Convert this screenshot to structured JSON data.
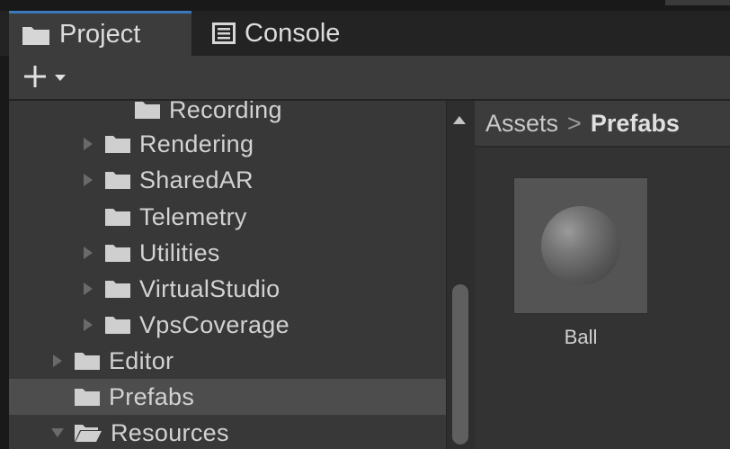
{
  "tabs": [
    {
      "label": "Project",
      "icon": "folder-icon",
      "active": true
    },
    {
      "label": "Console",
      "icon": "console-icon",
      "active": false
    }
  ],
  "toolbar": {
    "add_label": "+",
    "add_icon": "plus-icon",
    "dropdown_icon": "caret-down-icon"
  },
  "tree": {
    "items": [
      {
        "label": "Recording",
        "has_arrow": false,
        "expanded": false,
        "selected": false
      },
      {
        "label": "Rendering",
        "has_arrow": true,
        "expanded": false,
        "selected": false
      },
      {
        "label": "SharedAR",
        "has_arrow": true,
        "expanded": false,
        "selected": false
      },
      {
        "label": "Telemetry",
        "has_arrow": false,
        "expanded": false,
        "selected": false
      },
      {
        "label": "Utilities",
        "has_arrow": true,
        "expanded": false,
        "selected": false
      },
      {
        "label": "VirtualStudio",
        "has_arrow": true,
        "expanded": false,
        "selected": false
      },
      {
        "label": "VpsCoverage",
        "has_arrow": true,
        "expanded": false,
        "selected": false
      },
      {
        "label": "Editor",
        "has_arrow": true,
        "expanded": false,
        "selected": false
      },
      {
        "label": "Prefabs",
        "has_arrow": false,
        "expanded": false,
        "selected": true
      },
      {
        "label": "Resources",
        "has_arrow": true,
        "expanded": true,
        "selected": false
      }
    ]
  },
  "breadcrumb": {
    "root": "Assets",
    "separator": ">",
    "current": "Prefabs"
  },
  "assets": [
    {
      "label": "Ball",
      "icon": "sphere-prefab-icon"
    }
  ],
  "colors": {
    "accent": "#3a79bb",
    "panel": "#383838",
    "selected_row": "#4d4d4d"
  }
}
